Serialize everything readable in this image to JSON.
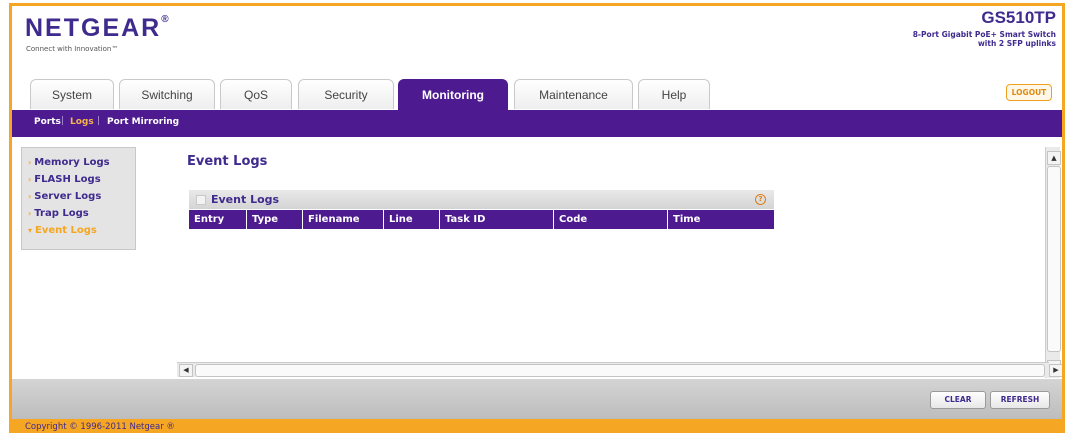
{
  "header": {
    "logo": "NETGEAR",
    "tagline": "Connect with Innovation™",
    "model": "GS510TP",
    "model_desc_line1": "8-Port Gigabit PoE+ Smart Switch",
    "model_desc_line2": "with 2 SFP uplinks"
  },
  "tabs": [
    "System",
    "Switching",
    "QoS",
    "Security",
    "Monitoring",
    "Maintenance",
    "Help"
  ],
  "active_tab": "Monitoring",
  "logout_label": "LOGOUT",
  "submenu": {
    "items": [
      "Ports",
      "Logs",
      "Port Mirroring"
    ],
    "active": "Logs"
  },
  "leftnav": {
    "items": [
      "Memory Logs",
      "FLASH Logs",
      "Server Logs",
      "Trap Logs",
      "Event Logs"
    ],
    "active": "Event Logs"
  },
  "main": {
    "page_title": "Event Logs",
    "panel_title": "Event Logs",
    "help_icon": "?",
    "columns": [
      "Entry",
      "Type",
      "Filename",
      "Line",
      "Task ID",
      "Code",
      "Time"
    ],
    "rows": []
  },
  "buttons": {
    "clear": "CLEAR",
    "refresh": "REFRESH"
  },
  "footer": {
    "copyright": "Copyright © 1996-2011 Netgear ®"
  },
  "colors": {
    "brand_purple": "#4d1b8f",
    "accent_orange": "#f5a623"
  }
}
